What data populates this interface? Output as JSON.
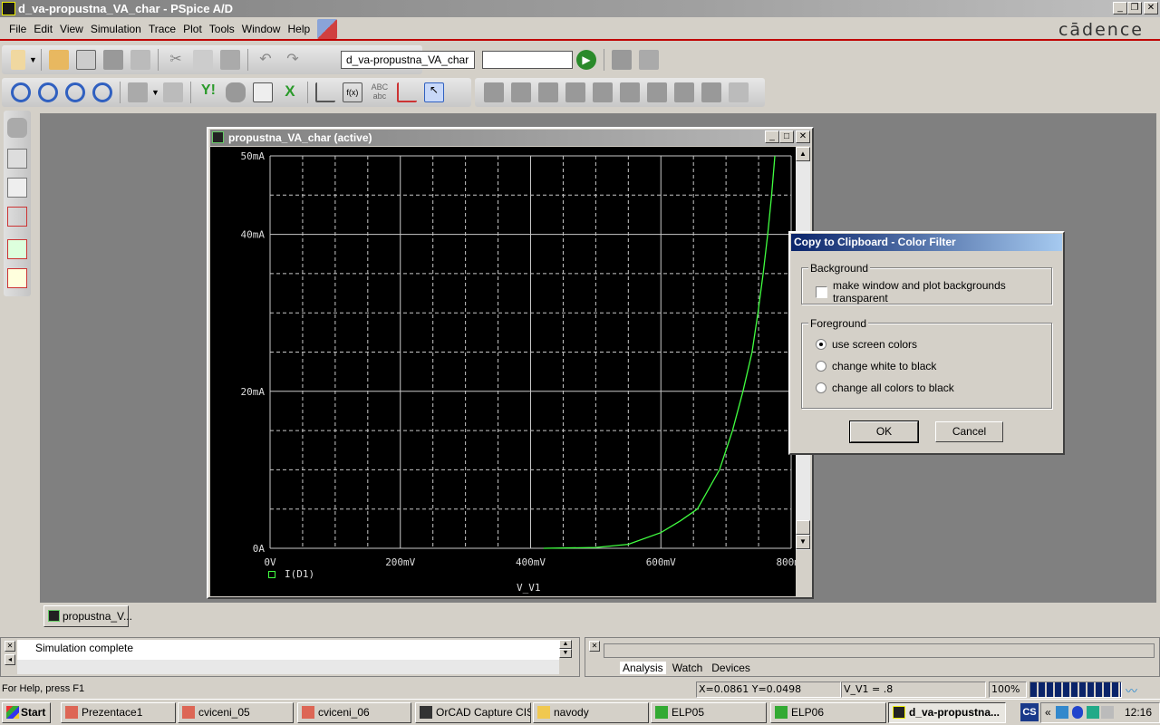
{
  "window": {
    "title": "d_va-propustna_VA_char - PSpice A/D",
    "brand": "cādence"
  },
  "menu": [
    "File",
    "Edit",
    "View",
    "Simulation",
    "Trace",
    "Plot",
    "Tools",
    "Window",
    "Help"
  ],
  "toolbar": {
    "profile_value": "d_va-propustna_VA_char",
    "sim_value": ""
  },
  "plot_window": {
    "title": "propustna_VA_char (active)",
    "tab_label": "propustna_V..."
  },
  "chart_data": {
    "type": "line",
    "xlabel": "V_V1",
    "x_ticks": [
      "0V",
      "200mV",
      "400mV",
      "600mV",
      "800mV"
    ],
    "y_ticks": [
      "0A",
      "20mA",
      "40mA",
      "50mA"
    ],
    "xlim": [
      0,
      0.8
    ],
    "ylim": [
      0,
      0.05
    ],
    "x_unit": "V",
    "y_unit": "A",
    "grid": true,
    "background": "#000000",
    "trace_color": "#40ff40",
    "legend": "bottom-left",
    "series": [
      {
        "name": "I(D1)",
        "x": [
          0.42,
          0.5,
          0.55,
          0.6,
          0.63,
          0.656,
          0.69,
          0.71,
          0.726,
          0.74,
          0.749,
          0.757,
          0.764,
          0.77,
          0.775
        ],
        "y": [
          0,
          0.0001,
          0.0005,
          0.002,
          0.0035,
          0.005,
          0.01,
          0.015,
          0.02,
          0.025,
          0.03,
          0.035,
          0.04,
          0.045,
          0.05
        ]
      }
    ]
  },
  "dialog": {
    "title": "Copy to Clipboard - Color Filter",
    "background_group": "Background",
    "transparent_label": "make window and plot backgrounds transparent",
    "transparent_checked": false,
    "foreground_group": "Foreground",
    "options": [
      "use screen colors",
      "change white to black",
      "change all colors to black"
    ],
    "selected_option": 0,
    "ok": "OK",
    "cancel": "Cancel"
  },
  "output": {
    "message": "Simulation complete"
  },
  "watch": {
    "tabs": [
      "Analysis",
      "Watch",
      "Devices"
    ],
    "active_tab": "Analysis"
  },
  "status": {
    "help": "For Help, press F1",
    "coords": "X=0.0861  Y=0.0498",
    "sweep": "V_V1 =  .8",
    "percent": "100%",
    "progress": 1.0
  },
  "taskbar": {
    "start": "Start",
    "tasks": [
      "Prezentace1",
      "cviceni_05",
      "cviceni_06",
      "OrCAD Capture CIS",
      "navody",
      "ELP05",
      "ELP06",
      "d_va-propustna..."
    ],
    "active_task": 7,
    "lang": "CS",
    "clock": "12:16"
  }
}
